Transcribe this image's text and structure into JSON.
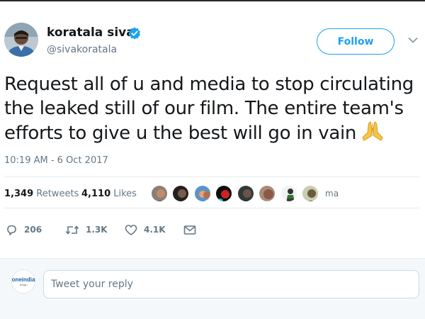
{
  "author": {
    "name": "koratala siva",
    "handle": "@sivakoratala",
    "verified": true
  },
  "follow_label": "Follow",
  "tweet": {
    "text": "Request all of u and media to stop circulating the leaked still of our film. The entire team's efforts to give u the best will go in vain",
    "emoji": "folded-hands",
    "timestamp": "10:19 AM - 6 Oct 2017"
  },
  "stats": {
    "retweets_count": "1,349",
    "retweets_label": "Retweets",
    "likes_count": "4,110",
    "likes_label": "Likes",
    "likers_more": "ma"
  },
  "actions": {
    "reply_count": "206",
    "retweet_count": "1.3K",
    "like_count": "4.1K"
  },
  "reply": {
    "placeholder": "Tweet your reply",
    "avatar_logo": "oneindia",
    "avatar_sub": "telugu"
  },
  "colors": {
    "accent": "#1da1f2",
    "text": "#14171a",
    "muted": "#657786",
    "divider": "#e6ecf0",
    "reply_bg": "#f5f8fa"
  }
}
